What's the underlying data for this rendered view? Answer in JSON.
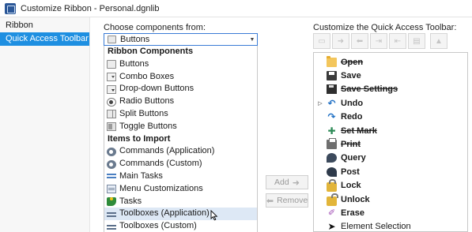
{
  "window": {
    "title": "Customize Ribbon - Personal.dgnlib"
  },
  "leftnav": {
    "items": [
      {
        "label": "Ribbon",
        "active": false
      },
      {
        "label": "Quick Access Toolbar",
        "active": true
      }
    ]
  },
  "left_panel": {
    "label": "Choose components from:",
    "combo": {
      "value": "Buttons"
    },
    "list": [
      {
        "type": "group",
        "label": "Ribbon Components"
      },
      {
        "type": "item",
        "label": "Buttons",
        "icon": "button-icon"
      },
      {
        "type": "item",
        "label": "Combo Boxes",
        "icon": "combo-box-icon"
      },
      {
        "type": "item",
        "label": "Drop-down Buttons",
        "icon": "dropdown-button-icon"
      },
      {
        "type": "item",
        "label": "Radio Buttons",
        "icon": "radio-button-icon"
      },
      {
        "type": "item",
        "label": "Split Buttons",
        "icon": "split-button-icon"
      },
      {
        "type": "item",
        "label": "Toggle Buttons",
        "icon": "toggle-button-icon"
      },
      {
        "type": "group",
        "label": "Items to Import"
      },
      {
        "type": "item",
        "label": "Commands (Application)",
        "icon": "gear-icon"
      },
      {
        "type": "item",
        "label": "Commands (Custom)",
        "icon": "gear-icon"
      },
      {
        "type": "item",
        "label": "Main Tasks",
        "icon": "tasks-icon"
      },
      {
        "type": "item",
        "label": "Menu Customizations",
        "icon": "menu-icon"
      },
      {
        "type": "item",
        "label": "Tasks",
        "icon": "task-icon"
      },
      {
        "type": "item",
        "label": "Toolboxes (Application)",
        "icon": "toolbox-icon",
        "hover": true
      },
      {
        "type": "item",
        "label": "Toolboxes (Custom)",
        "icon": "toolbox-icon"
      }
    ]
  },
  "middle": {
    "add_label": "Add",
    "remove_label": "Remove"
  },
  "right_panel": {
    "label": "Customize the Quick Access Toolbar:",
    "items": [
      {
        "label": "Open",
        "icon": "folder-icon",
        "strike": true
      },
      {
        "label": "Save",
        "icon": "save-icon",
        "strike": false
      },
      {
        "label": "Save Settings",
        "icon": "save-settings-icon",
        "strike": true
      },
      {
        "label": "Undo",
        "icon": "undo-icon",
        "strike": false,
        "expander": true
      },
      {
        "label": "Redo",
        "icon": "redo-icon",
        "strike": false
      },
      {
        "label": "Set Mark",
        "icon": "set-mark-icon",
        "strike": true
      },
      {
        "label": "Print",
        "icon": "print-icon",
        "strike": true
      },
      {
        "label": "Query",
        "icon": "query-icon",
        "strike": false
      },
      {
        "label": "Post",
        "icon": "post-icon",
        "strike": false
      },
      {
        "label": "Lock",
        "icon": "lock-icon",
        "strike": false
      },
      {
        "label": "Unlock",
        "icon": "unlock-icon",
        "strike": false
      },
      {
        "label": "Erase",
        "icon": "erase-icon",
        "strike": false
      },
      {
        "label": "Element Selection",
        "icon": "select-arrow-icon",
        "strike": false,
        "normal": true
      }
    ]
  }
}
